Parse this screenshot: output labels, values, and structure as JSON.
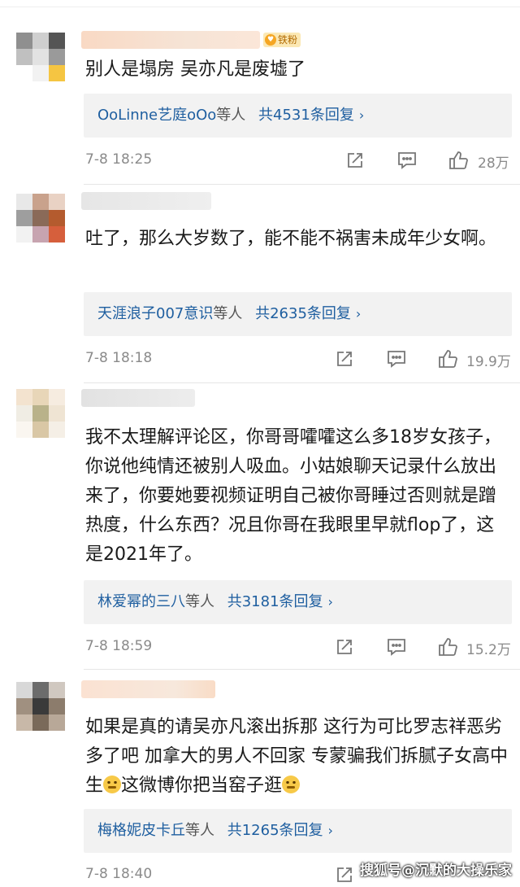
{
  "comments": [
    {
      "badge": "铁粉",
      "text": "别人是塌房 吴亦凡是废墟了",
      "reply_who": "OoLinne艺庭oOo",
      "reply_etc": "等人",
      "reply_count": "共4531条回复",
      "time": "7-8 18:25",
      "likes": "28万"
    },
    {
      "text": "吐了，那么大岁数了，能不能不祸害未成年少女啊。",
      "reply_who": "天涯浪子007意识",
      "reply_etc": "等人",
      "reply_count": "共2635条回复",
      "time": "7-8 18:18",
      "likes": "19.9万"
    },
    {
      "text": "我不太理解评论区，你哥哥嚯嚯这么多18岁女孩子，你说他纯情还被别人吸血。小姑娘聊天记录什么放出来了，你要她要视频证明自己被你哥睡过否则就是蹭热度，什么东西？况且你哥在我眼里早就flop了，这是2021年了。",
      "reply_who": "林爱幂的三八",
      "reply_etc": "等人",
      "reply_count": "共3181条回复",
      "time": "7-8 18:59",
      "likes": "15.2万"
    },
    {
      "text_a": "如果是真的请吴亦凡滚出拆那 这行为可比罗志祥恶劣多了吧 加拿大的男人不回家 专蒙骗我们拆腻子女高中生",
      "text_b": "这微博你把当窑子逛",
      "reply_who": "梅格妮皮卡丘",
      "reply_etc": "等人",
      "reply_count": "共1265条回复",
      "time": "7-8 18:40"
    }
  ],
  "icons": {
    "repost": "repost-icon",
    "comment": "comment-icon",
    "like": "thumbs-up-icon",
    "emoji": "thinking-face-emoji-icon",
    "reply_chevron": "chevron-right-icon"
  },
  "reply_chevron_glyph": "›",
  "watermark": "搜狐号@沉默的大操乐家",
  "colors": {
    "link": "#1f5fa0",
    "meta": "#8a8a8a",
    "reply_bg": "#f2f2f2",
    "badge_bg": "#fbe8b4"
  }
}
